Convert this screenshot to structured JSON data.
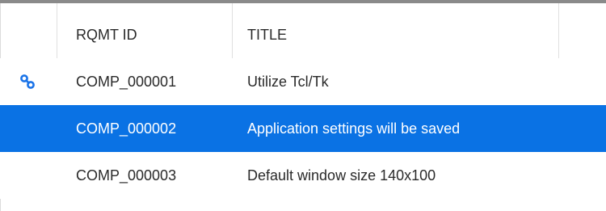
{
  "table": {
    "columns": [
      {
        "label": ""
      },
      {
        "label": "RQMT ID"
      },
      {
        "label": "TITLE"
      },
      {
        "label": ""
      }
    ],
    "rows": [
      {
        "id": "COMP_000001",
        "title": "Utilize Tcl/Tk",
        "icon": "link-icon",
        "selected": false
      },
      {
        "id": "COMP_000002",
        "title": "Application settings will be saved",
        "icon": "",
        "selected": true
      },
      {
        "id": "COMP_000003",
        "title": "Default window size 140x100",
        "icon": "",
        "selected": false
      }
    ]
  },
  "colors": {
    "selection": "#0a72e4",
    "link_icon": "#1a73e8",
    "header_border": "#8a8a8a"
  }
}
